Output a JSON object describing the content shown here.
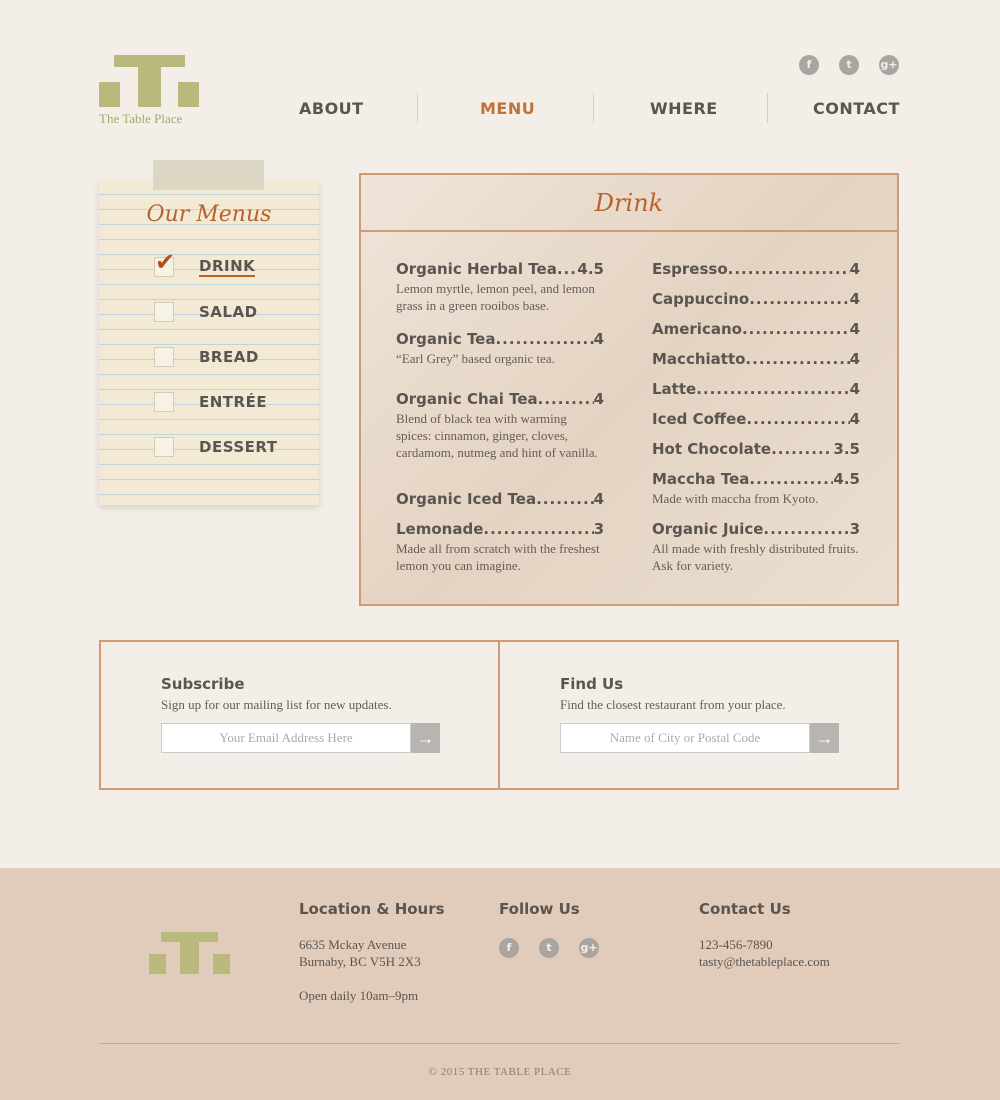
{
  "brand": {
    "name": "The Table Place",
    "logo_color": "#b9b97e",
    "accent": "#b8622e"
  },
  "nav": [
    {
      "label": "ABOUT"
    },
    {
      "label": "MENU",
      "active": true
    },
    {
      "label": "WHERE"
    },
    {
      "label": "CONTACT"
    }
  ],
  "social": [
    {
      "icon": "facebook-icon",
      "glyph": "f"
    },
    {
      "icon": "twitter-icon",
      "glyph": "t"
    },
    {
      "icon": "google-plus-icon",
      "glyph": "g+"
    }
  ],
  "sidebar": {
    "title": "Our Menus",
    "items": [
      {
        "label": "DRINK",
        "checked": true
      },
      {
        "label": "SALAD"
      },
      {
        "label": "BREAD"
      },
      {
        "label": "ENTRÉE"
      },
      {
        "label": "DESSERT"
      }
    ]
  },
  "menu": {
    "title": "Drink",
    "left": [
      {
        "name": "Organic Herbal Tea",
        "price": "4.5",
        "desc": "Lemon myrtle, lemon peel, and lemon grass in a green rooibos base."
      },
      {
        "name": "Organic Tea",
        "price": "4",
        "desc": "“Earl Grey” based organic tea."
      },
      {
        "name": "Organic Chai Tea",
        "price": "4",
        "desc": "Blend of black tea with warming spices: cinnamon, ginger, cloves, cardamom, nutmeg and hint of vanilla."
      },
      {
        "name": "Organic Iced Tea",
        "price": "4",
        "desc": ""
      },
      {
        "name": "Lemonade",
        "price": "3",
        "desc": "Made all from scratch with the freshest lemon you can imagine."
      }
    ],
    "right": [
      {
        "name": "Espresso",
        "price": "4",
        "desc": ""
      },
      {
        "name": "Cappuccino",
        "price": "4",
        "desc": ""
      },
      {
        "name": "Americano",
        "price": "4",
        "desc": ""
      },
      {
        "name": "Macchiatto",
        "price": "4",
        "desc": ""
      },
      {
        "name": "Latte",
        "price": "4",
        "desc": ""
      },
      {
        "name": "Iced Coffee",
        "price": "4",
        "desc": ""
      },
      {
        "name": "Hot Chocolate",
        "price": "3.5",
        "desc": ""
      },
      {
        "name": "Maccha Tea",
        "price": "4.5",
        "desc": "Made with maccha from Kyoto."
      },
      {
        "name": "Organic Juice",
        "price": "3",
        "desc": "All made with freshly distributed fruits. Ask for variety."
      }
    ]
  },
  "subscribe": {
    "title": "Subscribe",
    "text": "Sign up for our mailing list for new updates.",
    "placeholder": "Your Email Address Here"
  },
  "findus": {
    "title": "Find Us",
    "text": "Find the closest restaurant from your place.",
    "placeholder": "Name of City or Postal Code"
  },
  "footer": {
    "location_title": "Location & Hours",
    "address1": "6635 Mckay Avenue",
    "address2": "Burnaby, BC V5H 2X3",
    "hours": "Open daily 10am–9pm",
    "follow_title": "Follow Us",
    "contact_title": "Contact Us",
    "phone": "123-456-7890",
    "email": "tasty@thetableplace.com",
    "copyright": "© 2015 THE TABLE PLACE"
  }
}
